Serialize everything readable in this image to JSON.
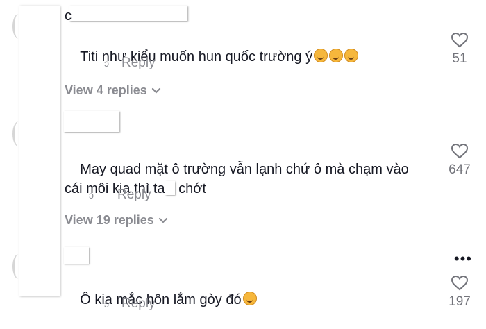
{
  "comments": [
    {
      "username": "c",
      "text": "Titi như kiểu muốn hun quốc trường ý",
      "emoji_count": 3,
      "reply_label": "Reply",
      "like_count": "51",
      "view_replies": "View 4 replies"
    },
    {
      "username": "",
      "text_before": "May quad mặt ô trường vẫn lạnh chứ ô mà chạm vào cái môi kia thì ta",
      "text_after": "chớt",
      "reply_label": "Reply",
      "like_count": "647",
      "view_replies": "View 19 replies"
    },
    {
      "username": "",
      "text": "Ô kia mắc hôn lắm gòy đó",
      "emoji_count": 1,
      "reply_label": "Reply",
      "like_count": "197",
      "more_label": "•••"
    }
  ],
  "icons": {
    "like": "heart-outline-icon",
    "expand": "chevron-down-icon",
    "more": "more-horizontal-icon"
  },
  "colors": {
    "text": "#161823",
    "secondary": "#8a8b91"
  }
}
